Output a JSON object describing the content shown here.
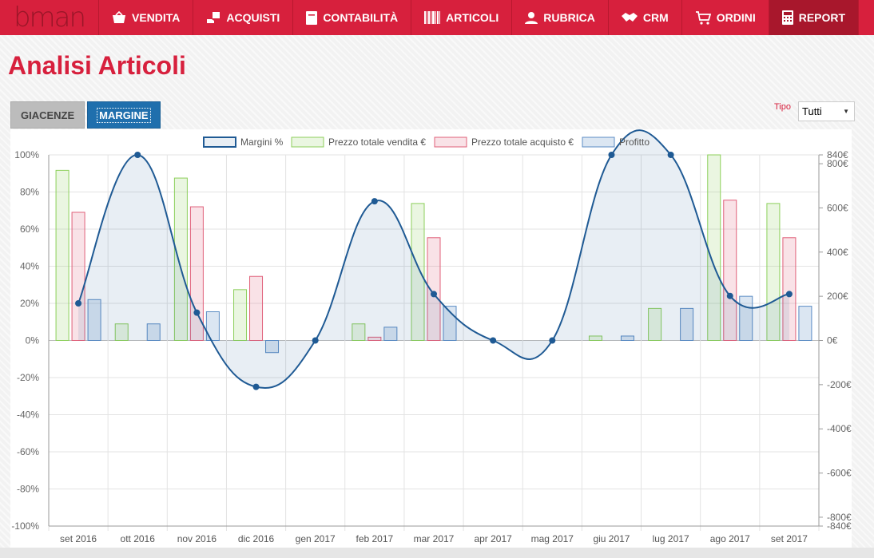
{
  "app": {
    "logo_text": "bman"
  },
  "nav": {
    "items": [
      {
        "label": "VENDITA",
        "icon": "basket-icon",
        "active": false
      },
      {
        "label": "ACQUISTI",
        "icon": "hand-bag-icon",
        "active": false
      },
      {
        "label": "CONTABILITÀ",
        "icon": "document-icon",
        "active": false
      },
      {
        "label": "ARTICOLI",
        "icon": "barcode-icon",
        "active": false
      },
      {
        "label": "RUBRICA",
        "icon": "user-icon",
        "active": false
      },
      {
        "label": "CRM",
        "icon": "handshake-icon",
        "active": false
      },
      {
        "label": "ORDINI",
        "icon": "cart-icon",
        "active": false
      },
      {
        "label": "REPORT",
        "icon": "calculator-icon",
        "active": true
      }
    ]
  },
  "page": {
    "title": "Analisi Articoli"
  },
  "tabs": [
    {
      "label": "GIACENZE",
      "active": false
    },
    {
      "label": "MARGINE",
      "active": true
    }
  ],
  "filter": {
    "label": "Tipo",
    "value": "Tutti"
  },
  "colors": {
    "brand": "#d7203d",
    "margin": "#1f5a94",
    "sales": "#8ccf5a",
    "purchase": "#e0607a",
    "profit": "#5b8cc4"
  },
  "chart_data": {
    "type": "bar",
    "categories": [
      "set 2016",
      "ott 2016",
      "nov 2016",
      "dic 2016",
      "gen 2017",
      "feb 2017",
      "mar 2017",
      "apr 2017",
      "mag 2017",
      "giu 2017",
      "lug 2017",
      "ago 2017",
      "set 2017"
    ],
    "series": [
      {
        "name": "Margini %",
        "type": "line",
        "axis": "left",
        "values": [
          20,
          100,
          15,
          -25,
          0,
          75,
          25,
          0,
          0,
          100,
          100,
          24,
          25
        ]
      },
      {
        "name": "Prezzo totale vendita €",
        "type": "bar",
        "axis": "right",
        "values": [
          770,
          75,
          735,
          230,
          0,
          75,
          620,
          0,
          0,
          20,
          145,
          840,
          620
        ]
      },
      {
        "name": "Prezzo totale acquisto €",
        "type": "bar",
        "axis": "right",
        "values": [
          580,
          0,
          605,
          290,
          0,
          15,
          465,
          0,
          0,
          0,
          0,
          635,
          465
        ]
      },
      {
        "name": "Profitto",
        "type": "bar",
        "axis": "right",
        "values": [
          185,
          75,
          130,
          -55,
          0,
          60,
          155,
          0,
          0,
          20,
          145,
          200,
          155
        ]
      }
    ],
    "y_left": {
      "min": -100,
      "max": 100,
      "ticks": [
        "100%",
        "80%",
        "60%",
        "40%",
        "20%",
        "0%",
        "-20%",
        "-40%",
        "-60%",
        "-80%",
        "-100%"
      ]
    },
    "y_right": {
      "min": -840,
      "max": 840,
      "ticks": [
        {
          "v": 840,
          "label": "840€"
        },
        {
          "v": 800,
          "label": "800€"
        },
        {
          "v": 600,
          "label": "600€"
        },
        {
          "v": 400,
          "label": "400€"
        },
        {
          "v": 200,
          "label": "200€"
        },
        {
          "v": 0,
          "label": "0€"
        },
        {
          "v": -200,
          "label": "-200€"
        },
        {
          "v": -400,
          "label": "-400€"
        },
        {
          "v": -600,
          "label": "-600€"
        },
        {
          "v": -800,
          "label": "-800€"
        },
        {
          "v": -840,
          "label": "-840€"
        }
      ]
    },
    "legend_position": "top",
    "grid": true
  }
}
